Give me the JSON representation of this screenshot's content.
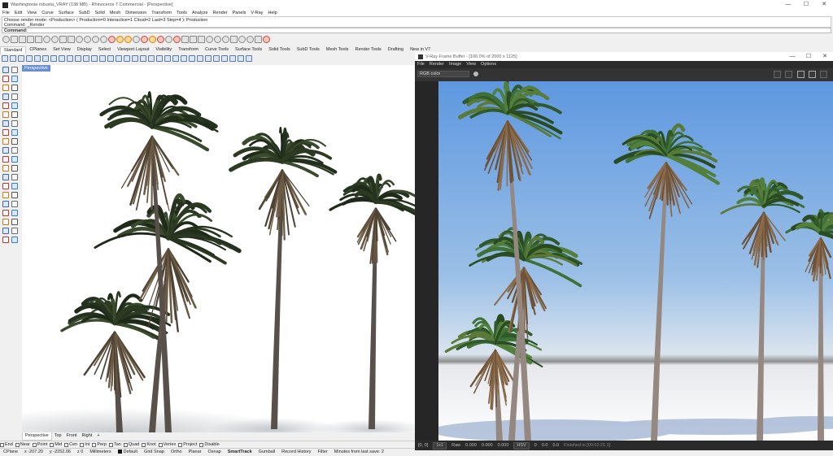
{
  "window": {
    "title": "Washingtonia robusta_VRAY (138 MB) - Rhinoceros 7 Commercial - [Perspective]",
    "controls": [
      "—",
      "☐",
      "✕"
    ]
  },
  "menu": [
    "File",
    "Edit",
    "View",
    "Curve",
    "Surface",
    "SubD",
    "Solid",
    "Mesh",
    "Dimension",
    "Transform",
    "Tools",
    "Analyze",
    "Render",
    "Panels",
    "V-Ray",
    "Help"
  ],
  "command_history": [
    "Choose render mode: <Production> ( Production=0  Interactive=1  Cloud=2  Last=3  Step=4 ): Production",
    "Command: _Render"
  ],
  "command_prompt": "Command:",
  "tabs": [
    "Standard",
    "CPlanes",
    "Set View",
    "Display",
    "Select",
    "Viewport Layout",
    "Visibility",
    "Transform",
    "Curve Tools",
    "Surface Tools",
    "Solid Tools",
    "SubD Tools",
    "Mesh Tools",
    "Render Tools",
    "Drafting",
    "New in V7"
  ],
  "active_tab": "Standard",
  "viewport": {
    "label": "Perspective"
  },
  "viewport_tabs": [
    "Perspective",
    "Top",
    "Front",
    "Right",
    "+"
  ],
  "osnap": [
    "End",
    "Near",
    "Point",
    "Mid",
    "Cen",
    "Int",
    "Perp",
    "Tan",
    "Quad",
    "Knot",
    "Vertex",
    "Project",
    "Disable"
  ],
  "status": {
    "cplane": "CPlane",
    "x": "x -207.20",
    "y": "y -2252.06",
    "z": "z 0",
    "units": "Millimeters",
    "layer": "Default",
    "items": [
      "Grid Snap",
      "Ortho",
      "Planar",
      "Osnap",
      "SmartTrack",
      "Gumball",
      "Record History",
      "Filter"
    ],
    "active_item": "SmartTrack",
    "save_msg": "Minutes from last save: 2"
  },
  "vfb": {
    "title": "V-Ray Frame Buffer - [100.0% of 2000 x 1125]",
    "menu": [
      "File",
      "Render",
      "Image",
      "View",
      "Options"
    ],
    "channel": "RGB color",
    "bottom": {
      "coords": "[0, 0]",
      "zoom": "1x1",
      "mode": "Raw",
      "r": "0.000",
      "g": "0.000",
      "b": "0.000",
      "space": "HSV",
      "h": "0",
      "s": "0.0",
      "v": "0.0",
      "status": "Finished in [00:02:21.1]"
    }
  },
  "colors": {
    "accent": "#6a8fd0",
    "vfb_bg": "#2b2b2b",
    "sky_top": "#5e98e0",
    "sky_horizon": "#dbe4ee"
  }
}
